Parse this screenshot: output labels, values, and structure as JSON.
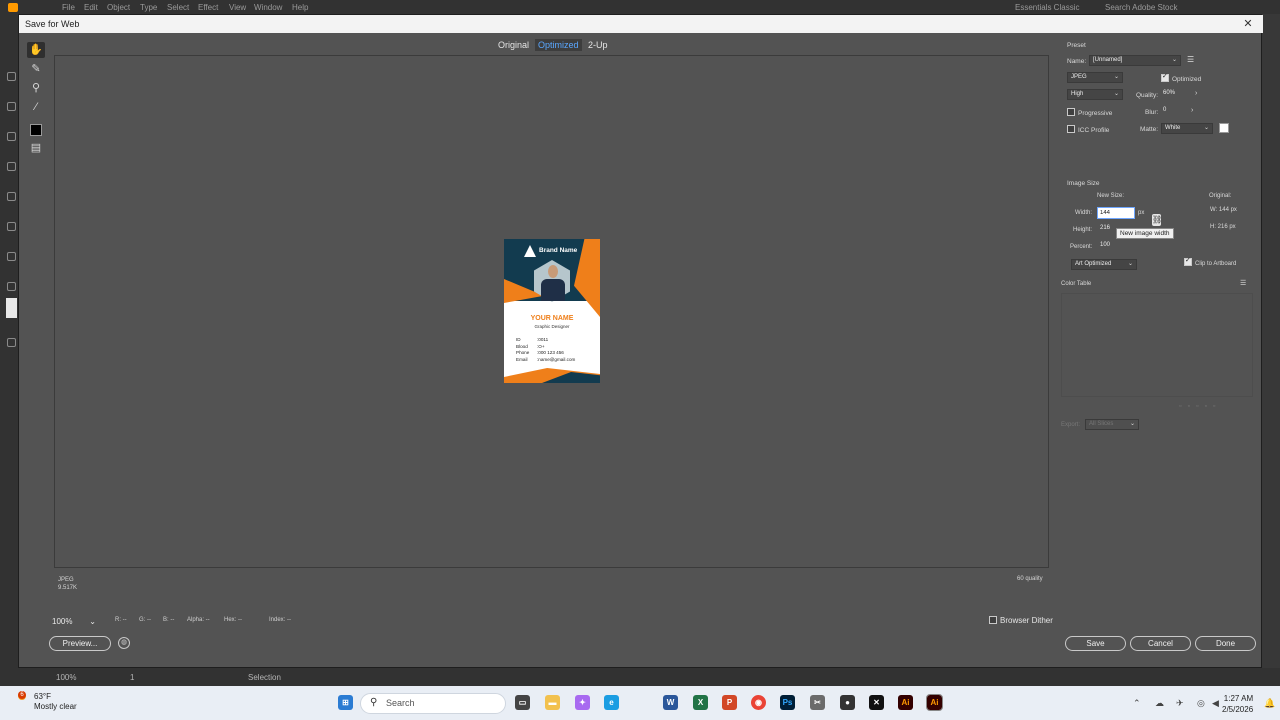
{
  "illustrator": {
    "menu": [
      "File",
      "Edit",
      "Object",
      "Type",
      "Select",
      "Effect",
      "View",
      "Window",
      "Help"
    ],
    "workspace": "Essentials Classic",
    "search_placeholder": "Search Adobe Stock",
    "status": {
      "zoom": "100%",
      "artboard": "1",
      "tool": "Selection"
    }
  },
  "dialog": {
    "title": "Save for Web",
    "tabs": [
      "Original",
      "Optimized",
      "2-Up"
    ],
    "active_tab": "Optimized",
    "preview": {
      "format": "JPEG",
      "size": "9.517K",
      "quality_note": "60 quality"
    },
    "card": {
      "brand": "Brand Name",
      "name": "YOUR NAME",
      "role": "Graphic Designer",
      "fields": [
        {
          "label": "ID",
          "value": ":0011"
        },
        {
          "label": "Blood",
          "value": ":O+"
        },
        {
          "label": "Phone",
          "value": ":000 123 456"
        },
        {
          "label": "Email",
          "value": ":name@gmail.com"
        }
      ]
    },
    "bottom": {
      "zoom": "100%",
      "r": "R: --",
      "g": "G: --",
      "b": "B: --",
      "alpha": "Alpha: --",
      "hex": "Hex: --",
      "index": "Index: --",
      "browser_dither": "Browser Dither",
      "preview_btn": "Preview...",
      "save_btn": "Save",
      "cancel_btn": "Cancel",
      "done_btn": "Done"
    },
    "preset": {
      "header": "Preset",
      "name_label": "Name:",
      "name_value": "[Unnamed]",
      "format": "JPEG",
      "optimized_label": "Optimized",
      "quality_level": "High",
      "quality_label": "Quality:",
      "quality_value": "60%",
      "progressive_label": "Progressive",
      "blur_label": "Blur:",
      "blur_value": "0",
      "icc_label": "ICC Profile",
      "matte_label": "Matte:",
      "matte_value": "White",
      "matte_color": "#ffffff"
    },
    "image_size": {
      "header": "Image Size",
      "new_size": "New Size:",
      "original": "Original:",
      "width_label": "Width:",
      "width_value": "144",
      "px": "px",
      "height_label": "Height:",
      "height_value": "216",
      "percent_label": "Percent:",
      "percent_value": "100",
      "orig_w": "W:  144 px",
      "orig_h": "H:  216 px",
      "tooltip": "New image width",
      "resample": "Art Optimized",
      "clip_label": "Clip to Artboard"
    },
    "color_table": {
      "header": "Color Table",
      "export_label": "Export:",
      "export_value": "All Slices"
    }
  },
  "taskbar": {
    "weather_temp": "63°F",
    "weather_desc": "Mostly clear",
    "weather_badge": "6",
    "search": "Search",
    "time": "1:27 AM",
    "date": "2/5/2026"
  }
}
